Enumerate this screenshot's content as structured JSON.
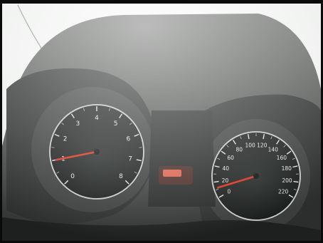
{
  "scene": {
    "subject": "car instrument cluster photographed in bright light",
    "colors": {
      "glare": "#f3f4f3",
      "hood": "#3f423f",
      "gauge_face": "#1b1f1e",
      "chrome_ring": "#c9cdcb",
      "needle": "#d8321e",
      "center_warning": "#d9624c"
    }
  },
  "tachometer": {
    "numbers": [
      "0",
      "1",
      "2",
      "3",
      "4",
      "5",
      "6",
      "7",
      "8"
    ],
    "needle_reading": 1.0
  },
  "speedometer": {
    "numbers": [
      "0",
      "20",
      "40",
      "60",
      "80",
      "100",
      "120",
      "140",
      "160",
      "180",
      "200",
      "220"
    ],
    "needle_reading": 12
  },
  "center_display": {
    "icon": "warning-lamp-icon"
  }
}
